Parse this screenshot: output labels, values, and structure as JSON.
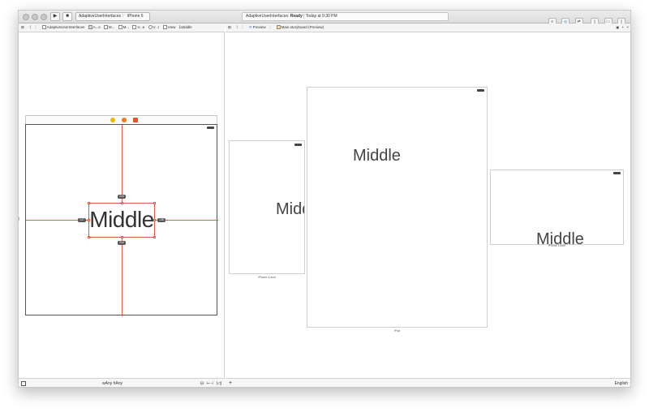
{
  "titlebar": {
    "run_icon": "▶",
    "stop_icon": "■",
    "scheme_target": "AdaptiveUserInterfaces",
    "scheme_device": "iPhone 6",
    "status_project": "AdaptiveUserInterfaces:",
    "status_state": "Ready",
    "status_time": "Today at 9:30 PM"
  },
  "left_jumpbar": {
    "items": [
      "AdaptiveUserInterfaces",
      "A...s",
      "M...",
      "M...",
      "V...e",
      "V...r",
      "View",
      "Middle"
    ]
  },
  "right_jumpbar": {
    "preview_label": "Preview",
    "file_label": "Main.storyboard (Preview)",
    "lock_icon": "🔒",
    "add_icon": "+",
    "close_icon": "×"
  },
  "canvas": {
    "label_text": "Middle",
    "constraint_top": "244",
    "constraint_left": "137",
    "constraint_right": "138",
    "constraint_bottom": "244"
  },
  "previews": [
    {
      "caption": "iPhone 4-inch",
      "text": "Middle"
    },
    {
      "caption": "iPad",
      "text": "Middle"
    },
    {
      "caption": "iPhone 4-inch",
      "text": "Middle"
    }
  ],
  "left_bottombar": {
    "size_class": "wAny hAny"
  },
  "right_bottombar": {
    "language": "English",
    "add_icon": "+"
  },
  "colors": {
    "constraint": "#e35b47",
    "scene_dock_yellow": "#f5b400",
    "scene_dock_orange": "#f07a1c",
    "scene_dock_red": "#e0562a"
  }
}
